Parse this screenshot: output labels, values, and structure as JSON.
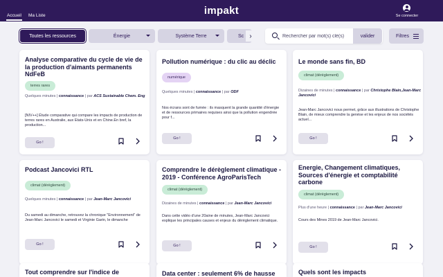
{
  "header": {
    "logo": "impakt",
    "tabs": [
      {
        "label": "Accueil",
        "active": true
      },
      {
        "label": "Ma Liste",
        "active": false
      }
    ],
    "login_label": "Se connecter",
    "user_icon": "user-circle-icon"
  },
  "filters": {
    "all_label": "Toutes les ressources",
    "chips": [
      "Énergie",
      "Système Terre",
      "Sc"
    ],
    "search_placeholder": "Rechercher par mot(s) clé(s)",
    "search_value": "",
    "validate_label": "valider",
    "filters_label": "Filtres"
  },
  "colors": {
    "header_bg": "#2f1a5a",
    "accent": "#2f1a5a",
    "chip_bg": "#d6d4e3",
    "tag_green": "#c9ecd7",
    "tag_purple": "#e4d3f4",
    "page_bg": "#f1f1f6"
  },
  "cards": [
    {
      "title": "Analyse comparative du cycle de vie de la production d'aimants permanents NdFeB",
      "tag": "terres rares",
      "duration": "Quelques minutes",
      "type": "connaissance",
      "by": "par",
      "author": "ACS Sustainable Chem. Eng",
      "description": "[NIV++] Étude comparative qui compare les impacts de production de terres rares en Australie, aux Etats-Unis et en Chine.En bref, la production...",
      "go_label": "Go !"
    },
    {
      "title": "Pollution numérique : du clic au déclic",
      "tag": "numérique",
      "duration": "Quelques minutes",
      "type": "connaissance",
      "by": "par",
      "author": "ODF",
      "description": "Nos écrans sont de fumée : ils masquent la grande quantité d'énergie et de ressources primaires requises ainsi que la pollution engendrée pour f...",
      "go_label": "Go !"
    },
    {
      "title": "Le monde sans fin, BD",
      "tag": "climat (dérèglement)",
      "duration": "Dizaines de minutes",
      "type": "connaissance",
      "by": "par",
      "author": "Christophe Blain,Jean-Marc Jancovici",
      "description": "Jean-Marc Jancovici nous permet, grâce aux illustrations de Christophe Blain, de mieux comprendre la genèse et les enjeux de nos sociétés actuel...",
      "go_label": "Go !"
    },
    {
      "title": "Podcast Jancovici RTL",
      "tag": "climat (dérèglement)",
      "duration": "Quelques minutes",
      "type": "connaissance",
      "by": "par",
      "author": "Jean-Marc Jancovici",
      "description": "Du samedi au dimanche, retrouvez la chronique \"Environnement\" de Jean-Marc Jancovici le samedi et Virginie Garin, le dimanche",
      "go_label": "Go !"
    },
    {
      "title": "Comprendre le dérèglement climatique - 2019 - Conférence AgroParisTech",
      "tag": "climat (dérèglement)",
      "duration": "Dizaines de minutes",
      "type": "connaissance",
      "by": "par",
      "author": "Jean-Marc Jancovici",
      "description": "Dans cette vidéo d'une 20aine de minutes, Jean-Marc Jancovici explique les principales causes et enjeux du dérèglement climatique.",
      "go_label": "Go !"
    },
    {
      "title": "Energie, Changement climatiques, Sources d'énergie et comptabilité carbone",
      "tag": "climat (dérèglement)",
      "duration": "Plus d'une heure",
      "type": "connaissance",
      "by": "par",
      "author": "Jean-Marc Jancovici",
      "description": "Cours des Mines 2019 de Jean-Marc Jancovici.",
      "go_label": "Go !"
    }
  ],
  "partial_cards": [
    {
      "title": "Tout comprendre sur l'indice de"
    },
    {
      "title": "Data center : seulement 6% de hausse"
    },
    {
      "title": "Quels sont les impacts"
    }
  ]
}
